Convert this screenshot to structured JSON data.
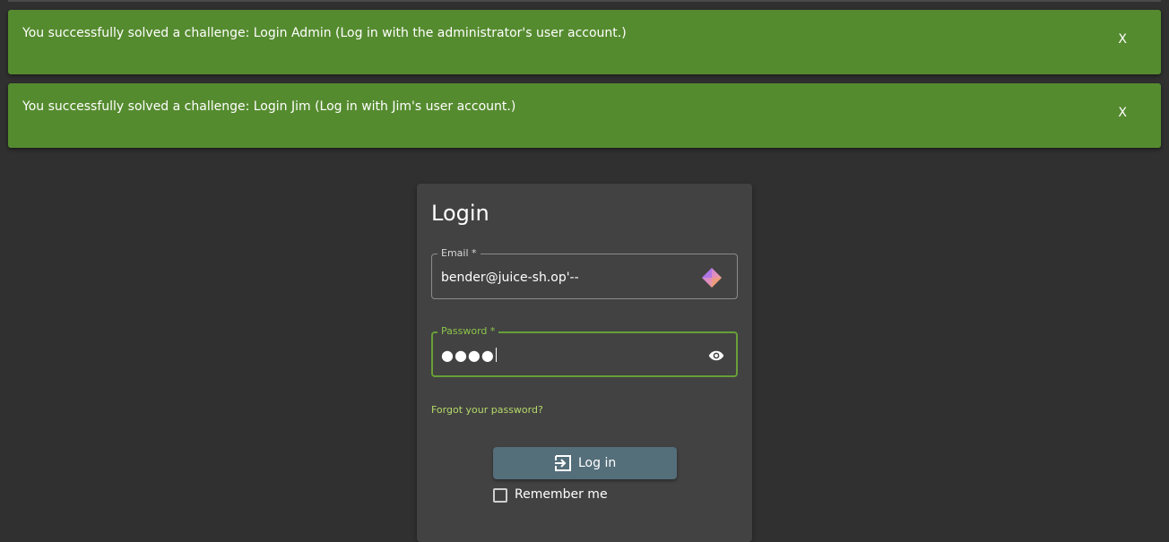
{
  "notifications": [
    {
      "message": "You successfully solved a challenge: Login Admin (Log in with the administrator's user account.)",
      "close_label": "X"
    },
    {
      "message": "You successfully solved a challenge: Login Jim (Log in with Jim's user account.)",
      "close_label": "X"
    }
  ],
  "login": {
    "title": "Login",
    "email": {
      "label": "Email *",
      "value": "bender@juice-sh.op'--"
    },
    "password": {
      "label": "Password *",
      "masked_value": "●●●●",
      "reveal_icon": "eye-icon"
    },
    "forgot_password_label": "Forgot your password?",
    "login_button_label": "Log in",
    "login_button_icon": "login-icon",
    "remember_me_label": "Remember me",
    "remember_me_checked": false
  },
  "colors": {
    "background": "#303030",
    "card": "#424242",
    "snackbar": "#558b2f",
    "accent_green": "#8bc34a",
    "button": "#546e7a"
  }
}
